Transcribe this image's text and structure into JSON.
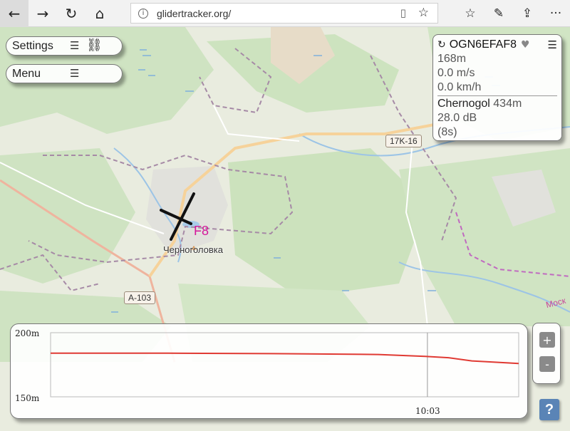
{
  "browser": {
    "url": "glidertracker.org/",
    "icons": [
      "back-arrow-icon",
      "forward-arrow-icon",
      "refresh-icon",
      "home-icon",
      "info-icon",
      "reading-view-icon",
      "favorite-star-icon",
      "favorites-list-icon",
      "pen-icon",
      "share-icon",
      "more-icon"
    ]
  },
  "controls": {
    "settings_label": "Settings",
    "menu_label": "Menu"
  },
  "info_panel": {
    "callsign": "OGN6EFAF8",
    "altitude": "168m",
    "vertical_speed": "0.0 m/s",
    "ground_speed": "0.0 km/h",
    "station_name": "Chernogol",
    "station_distance": "434m",
    "signal": "28.0 dB",
    "age": "(8s)"
  },
  "map": {
    "aircraft_tag": "F8",
    "town": "Черноголовка",
    "road_1": "17K-16",
    "road_2": "A-103",
    "edge_text": "Моск"
  },
  "chart_data": {
    "type": "line",
    "title": "",
    "xlabel": "",
    "ylabel": "",
    "y_tick_labels": [
      "200m",
      "150m"
    ],
    "ylim": [
      150,
      200
    ],
    "x_tick_label": "10:03",
    "series": [
      {
        "color": "#e03a33",
        "x": [
          0,
          0.25,
          0.5,
          0.7,
          0.8,
          0.85,
          0.9,
          1.0
        ],
        "y": [
          184,
          184,
          183.6,
          183,
          181.5,
          180.5,
          178,
          176
        ]
      }
    ],
    "grid": true
  },
  "zoom": {
    "in_label": "+",
    "out_label": "-"
  },
  "help_label": "?"
}
